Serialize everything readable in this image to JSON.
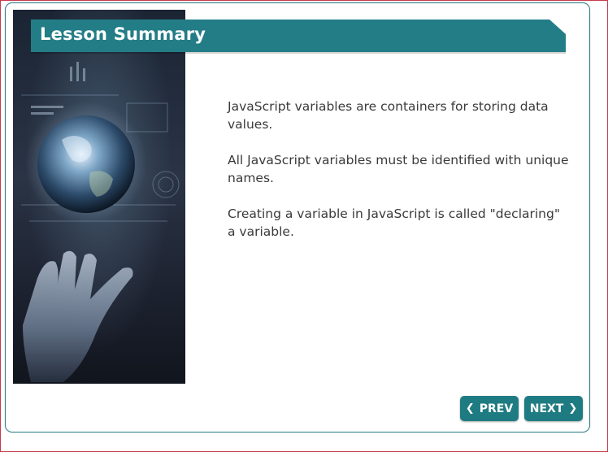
{
  "lesson": {
    "title": "Lesson Summary",
    "paragraphs": [
      "JavaScript variables are containers for storing data values.",
      "All JavaScript variables must be identified with unique names.",
      "Creating a variable in JavaScript is called \"declaring\" a variable."
    ]
  },
  "nav": {
    "prev_label": "PREV",
    "next_label": "NEXT",
    "prev_icon": "chevron-left-icon",
    "next_icon": "chevron-right-icon"
  },
  "colors": {
    "accent": "#1f7b82",
    "banner": "#237d86",
    "border": "#2e7f8a",
    "outer_border": "#c63a4a",
    "text": "#3a3a3a"
  }
}
